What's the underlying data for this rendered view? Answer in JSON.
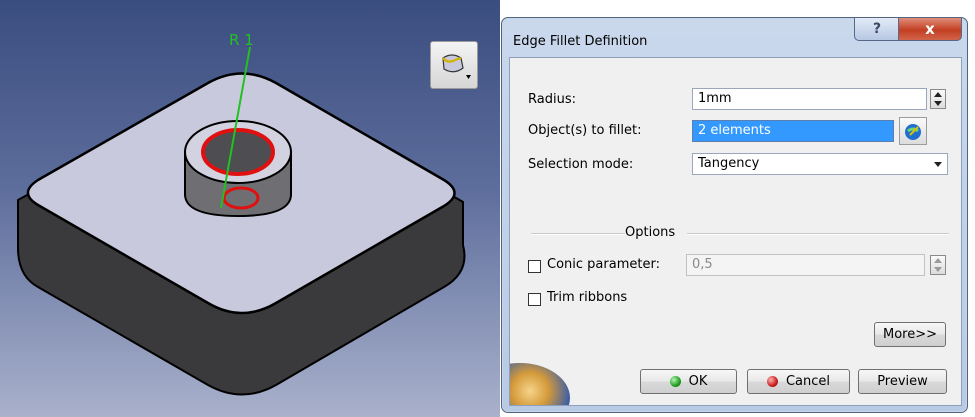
{
  "viewport": {
    "annotation": "R 1",
    "colors": {
      "edge_highlight": "#e01010",
      "annotation": "#22c022",
      "top_face": "#c9c9dd"
    }
  },
  "toolbar": {
    "fillet_icon": "edge-fillet-tool-icon"
  },
  "dialog": {
    "title": "Edge Fillet Definition",
    "help_label": "?",
    "close_label": "x",
    "radius": {
      "label": "Radius:",
      "value": "1mm"
    },
    "objects": {
      "label": "Object(s) to fillet:",
      "value": "2 elements"
    },
    "selection_mode": {
      "label": "Selection mode:",
      "value": "Tangency"
    },
    "options_label": "Options",
    "conic": {
      "label": "Conic parameter:",
      "value": "0,5",
      "checked": false
    },
    "trim_ribbons": {
      "label": "Trim ribbons",
      "checked": false
    },
    "more_label": "More>>",
    "ok_label": "OK",
    "cancel_label": "Cancel",
    "preview_label": "Preview"
  }
}
